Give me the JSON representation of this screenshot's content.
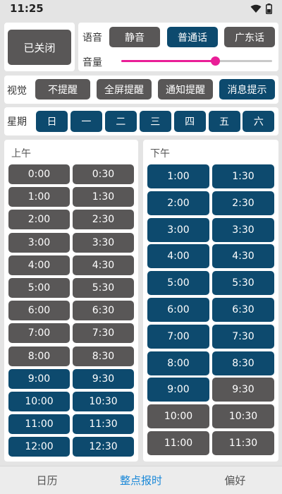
{
  "status": {
    "time": "11:25",
    "wifi_icon": "wifi-icon",
    "battery_icon": "battery-icon"
  },
  "power": {
    "label": "已关闭"
  },
  "voice": {
    "label": "语音",
    "options": [
      "静音",
      "普通话",
      "广东话"
    ],
    "selected_index": 1,
    "volume_label": "音量",
    "volume_value": 0.62
  },
  "visual": {
    "label": "视觉",
    "options": [
      "不提醒",
      "全屏提醒",
      "通知提醒",
      "消息提示"
    ],
    "selected_index": 3
  },
  "week": {
    "label": "星期",
    "days": [
      "日",
      "一",
      "二",
      "三",
      "四",
      "五",
      "六"
    ]
  },
  "morning": {
    "title": "上午",
    "slots": [
      {
        "t": "0:00",
        "on": false
      },
      {
        "t": "0:30",
        "on": false
      },
      {
        "t": "1:00",
        "on": false
      },
      {
        "t": "1:30",
        "on": false
      },
      {
        "t": "2:00",
        "on": false
      },
      {
        "t": "2:30",
        "on": false
      },
      {
        "t": "3:00",
        "on": false
      },
      {
        "t": "3:30",
        "on": false
      },
      {
        "t": "4:00",
        "on": false
      },
      {
        "t": "4:30",
        "on": false
      },
      {
        "t": "5:00",
        "on": false
      },
      {
        "t": "5:30",
        "on": false
      },
      {
        "t": "6:00",
        "on": false
      },
      {
        "t": "6:30",
        "on": false
      },
      {
        "t": "7:00",
        "on": false
      },
      {
        "t": "7:30",
        "on": false
      },
      {
        "t": "8:00",
        "on": false
      },
      {
        "t": "8:30",
        "on": false
      },
      {
        "t": "9:00",
        "on": true
      },
      {
        "t": "9:30",
        "on": true
      },
      {
        "t": "10:00",
        "on": true
      },
      {
        "t": "10:30",
        "on": true
      },
      {
        "t": "11:00",
        "on": true
      },
      {
        "t": "11:30",
        "on": true
      },
      {
        "t": "12:00",
        "on": true
      },
      {
        "t": "12:30",
        "on": true
      }
    ]
  },
  "afternoon": {
    "title": "下午",
    "slots": [
      {
        "t": "1:00",
        "on": true
      },
      {
        "t": "1:30",
        "on": true
      },
      {
        "t": "2:00",
        "on": true
      },
      {
        "t": "2:30",
        "on": true
      },
      {
        "t": "3:00",
        "on": true
      },
      {
        "t": "3:30",
        "on": true
      },
      {
        "t": "4:00",
        "on": true
      },
      {
        "t": "4:30",
        "on": true
      },
      {
        "t": "5:00",
        "on": true
      },
      {
        "t": "5:30",
        "on": true
      },
      {
        "t": "6:00",
        "on": true
      },
      {
        "t": "6:30",
        "on": true
      },
      {
        "t": "7:00",
        "on": true
      },
      {
        "t": "7:30",
        "on": true
      },
      {
        "t": "8:00",
        "on": true
      },
      {
        "t": "8:30",
        "on": true
      },
      {
        "t": "9:00",
        "on": true
      },
      {
        "t": "9:30",
        "on": false
      },
      {
        "t": "10:00",
        "on": false
      },
      {
        "t": "10:30",
        "on": false
      },
      {
        "t": "11:00",
        "on": false
      },
      {
        "t": "11:30",
        "on": false
      }
    ]
  },
  "tabs": [
    {
      "label": "日历",
      "active": false
    },
    {
      "label": "整点报时",
      "active": true
    },
    {
      "label": "偏好",
      "active": false
    }
  ],
  "colors": {
    "on": "#0d4a6e",
    "off": "#595757",
    "accent": "#e91e97",
    "tab_active": "#1a88d8"
  }
}
